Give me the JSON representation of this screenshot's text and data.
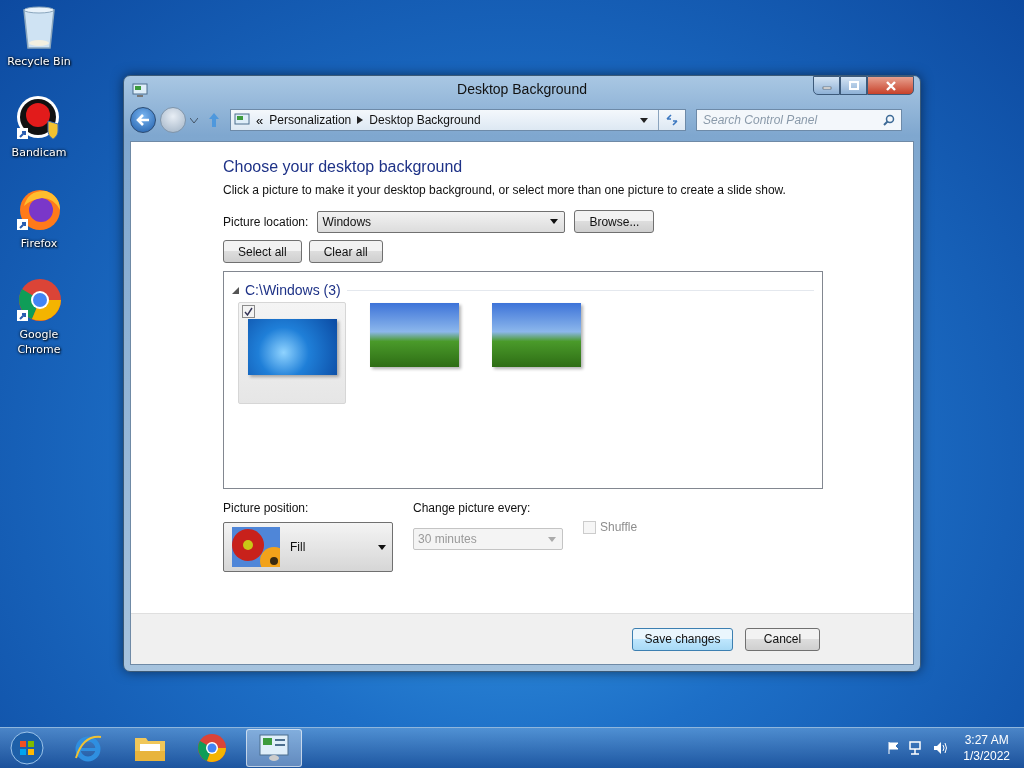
{
  "desktop_icons": [
    {
      "label": "Recycle Bin",
      "kind": "recycle"
    },
    {
      "label": "Bandicam",
      "kind": "bandicam"
    },
    {
      "label": "Firefox",
      "kind": "firefox"
    },
    {
      "label": "Google Chrome",
      "kind": "chrome"
    }
  ],
  "window": {
    "title": "Desktop Background",
    "breadcrumb": {
      "prefix": "«",
      "items": [
        "Personalization",
        "Desktop Background"
      ]
    },
    "search": {
      "placeholder": "Search Control Panel"
    },
    "heading": "Choose your desktop background",
    "description": "Click a picture to make it your desktop background, or select more than one picture to create a slide show.",
    "picture_location": {
      "label": "Picture location:",
      "value": "Windows"
    },
    "browse": "Browse...",
    "select_all": "Select all",
    "clear_all": "Clear all",
    "gallery": {
      "group": "C:\\Windows (3)",
      "expanded": true,
      "pictures": [
        {
          "kind": "logo",
          "selected": true
        },
        {
          "kind": "hill",
          "selected": false
        },
        {
          "kind": "hill",
          "selected": false
        }
      ]
    },
    "picture_position": {
      "label": "Picture position:",
      "value": "Fill"
    },
    "change_picture": {
      "label": "Change picture every:",
      "value": "30 minutes",
      "disabled": true
    },
    "shuffle": {
      "label": "Shuffle",
      "checked": false,
      "disabled": true
    },
    "footer_buttons": [
      {
        "label": "Save changes",
        "default": true
      },
      {
        "label": "Cancel",
        "default": false
      }
    ]
  },
  "taskbar": {
    "items": [
      {
        "kind": "ie",
        "active": false
      },
      {
        "kind": "explorer",
        "active": false
      },
      {
        "kind": "chrome",
        "active": false
      },
      {
        "kind": "control-panel",
        "active": true
      }
    ],
    "time": "3:27 AM",
    "date": "1/3/2022"
  }
}
